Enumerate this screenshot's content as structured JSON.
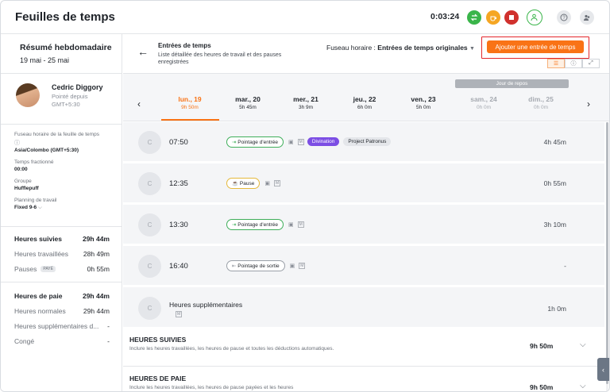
{
  "app": {
    "title": "Feuilles de temps",
    "timer": "0:03:24"
  },
  "colors": {
    "accent": "#f97316",
    "green_btn": "#3ab54a",
    "orange_btn": "#f5a623",
    "red_btn": "#d0312d",
    "highlight_box": "#e3262b"
  },
  "sidebar": {
    "week_title": "Résumé hebdomadaire",
    "week_range": "19 mai - 25 mai",
    "profile": {
      "name": "Cedric Diggory",
      "status": "Pointé depuis",
      "tz": "GMT+5:30"
    },
    "meta": [
      {
        "label": "Fuseau horaire de la feuille de temps",
        "value": "Asia/Colombo (GMT+5:30)"
      },
      {
        "label": "Temps fractionné",
        "value": "00:00"
      },
      {
        "label": "Groupe",
        "value": "Hufflepuff"
      },
      {
        "label": "Planning de travail",
        "value": "Fixed 9-6"
      }
    ],
    "tracked": [
      {
        "label": "Heures suivies",
        "value": "29h 44m"
      },
      {
        "label": "Heures travaillées",
        "value": "28h 49m"
      },
      {
        "label": "Pauses",
        "badge": "PAYÉ",
        "value": "0h 55m"
      }
    ],
    "pay": [
      {
        "label": "Heures de paie",
        "value": "29h 44m"
      },
      {
        "label": "Heures normales",
        "value": "29h 44m"
      },
      {
        "label": "Heures supplémentaires d...",
        "value": "-"
      },
      {
        "label": "Congé",
        "value": "-"
      }
    ]
  },
  "main": {
    "title": "Entrées de temps",
    "subtitle": "Liste détaillée des heures de travail et des pauses enregistrées",
    "tz_label": "Fuseau horaire :",
    "tz_value": "Entrées de temps originales",
    "add_button": "Ajouter une entrée de temps",
    "rest_day": "Jour de repos",
    "days": [
      {
        "name": "lun., 19",
        "hours": "9h 50m",
        "state": "active"
      },
      {
        "name": "mar., 20",
        "hours": "5h 45m",
        "state": "normal"
      },
      {
        "name": "mer., 21",
        "hours": "3h 9m",
        "state": "normal"
      },
      {
        "name": "jeu., 22",
        "hours": "6h 0m",
        "state": "normal"
      },
      {
        "name": "ven., 23",
        "hours": "5h 0m",
        "state": "normal"
      },
      {
        "name": "sam., 24",
        "hours": "0h 0m",
        "state": "muted"
      },
      {
        "name": "dim., 25",
        "hours": "0h 0m",
        "state": "muted"
      }
    ],
    "avatar_letter": "C",
    "manual_badge": "M",
    "entries": [
      {
        "time": "07:50",
        "type": "Pointage d'entrée",
        "kind": "green",
        "activity": "Divination",
        "project": "Project Patronus",
        "duration": "4h 45m"
      },
      {
        "time": "12:35",
        "type": "Pause",
        "kind": "yellow",
        "duration": "0h 55m"
      },
      {
        "time": "13:30",
        "type": "Pointage d'entrée",
        "kind": "green",
        "duration": "3h 10m"
      },
      {
        "time": "16:40",
        "type": "Pointage de sortie",
        "kind": "grey",
        "duration": "-"
      }
    ],
    "overtime": {
      "title": "Heures supplémentaires",
      "duration": "1h 0m"
    },
    "totals": [
      {
        "title": "HEURES SUIVIES",
        "subtitle": "Inclure les heures travaillées, les heures de pause et toutes les déductions automatiques.",
        "value": "9h 50m"
      },
      {
        "title": "HEURES DE PAIE",
        "subtitle": "Inclure les heures travaillées, les heures de pause payées et les heures",
        "value": "9h 50m"
      }
    ]
  }
}
